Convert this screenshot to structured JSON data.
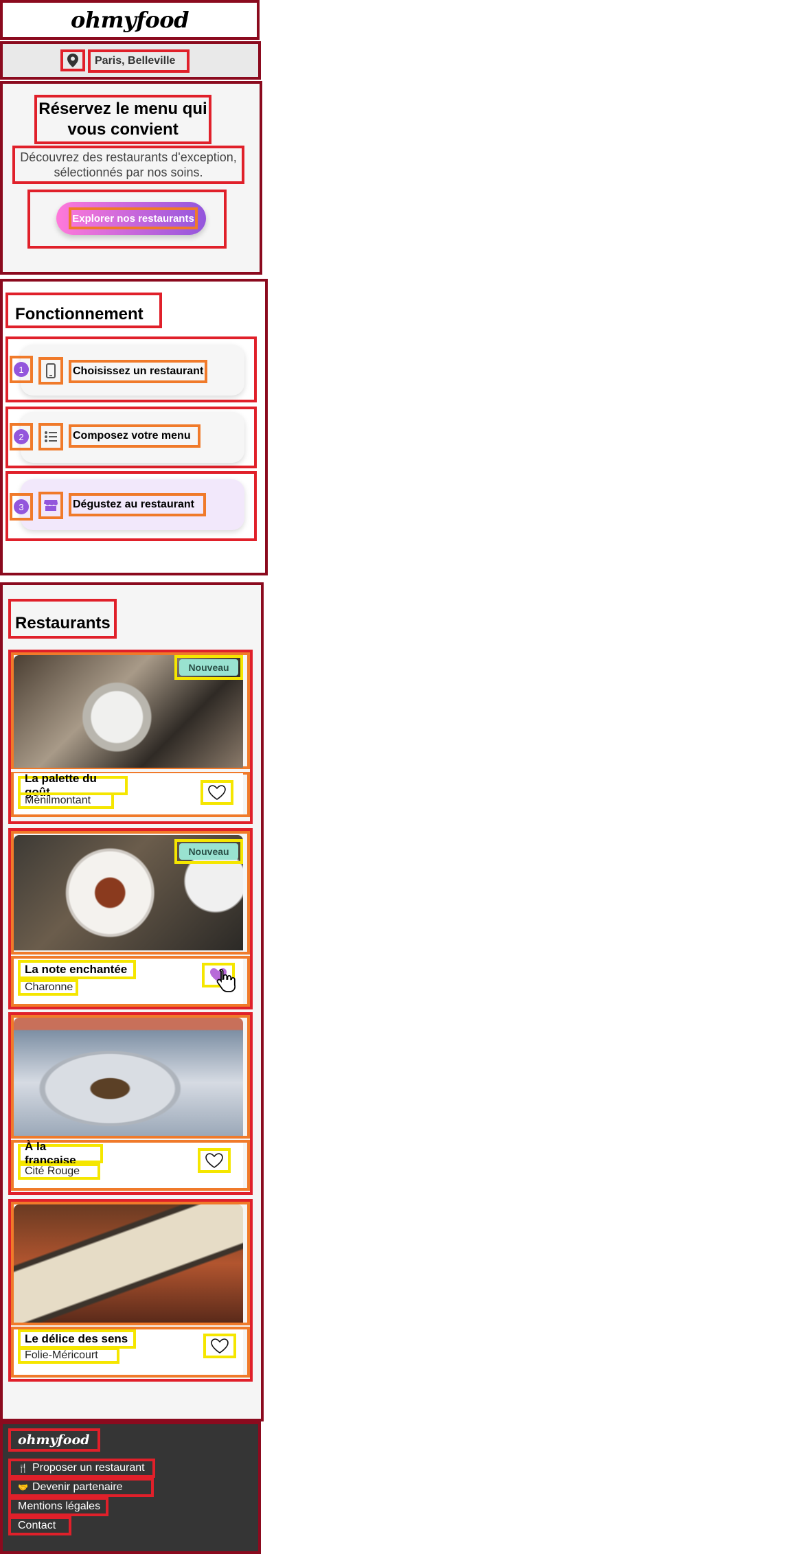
{
  "header": {
    "logo": "ohmyfood"
  },
  "location": {
    "icon": "map-pin-icon",
    "label": "Paris, Belleville"
  },
  "hero": {
    "title": "Réservez le menu qui vous convient",
    "subtitle": "Découvrez des restaurants d'exception, sélectionnés par nos soins.",
    "cta_label": "Explorer nos restaurants"
  },
  "how": {
    "title": "Fonctionnement",
    "steps": [
      {
        "number": "1",
        "icon": "smartphone-icon",
        "label": "Choisissez un restaurant"
      },
      {
        "number": "2",
        "icon": "list-icon",
        "label": "Composez votre menu"
      },
      {
        "number": "3",
        "icon": "store-icon",
        "label": "Dégustez au restaurant"
      }
    ]
  },
  "restaurants": {
    "title": "Restaurants",
    "items": [
      {
        "name": "La palette du goût",
        "district": "Ménilmontant",
        "badge": "Nouveau",
        "liked": false
      },
      {
        "name": "La note enchantée",
        "district": "Charonne",
        "badge": "Nouveau",
        "liked": true
      },
      {
        "name": "À la française",
        "district": "Cité Rouge",
        "badge": "",
        "liked": false
      },
      {
        "name": "Le délice des sens",
        "district": "Folie-Méricourt",
        "badge": "",
        "liked": false
      }
    ]
  },
  "footer": {
    "logo": "ohmyfood",
    "links": [
      {
        "icon": "utensils-icon",
        "label": "Proposer un restaurant"
      },
      {
        "icon": "handshake-icon",
        "label": "Devenir partenaire"
      },
      {
        "icon": "",
        "label": "Mentions légales"
      },
      {
        "icon": "",
        "label": "Contact"
      }
    ]
  },
  "colors": {
    "accent_from": "#ff79da",
    "accent_to": "#9356dc",
    "badge": "#99e2d0",
    "footer_bg": "#353535"
  }
}
